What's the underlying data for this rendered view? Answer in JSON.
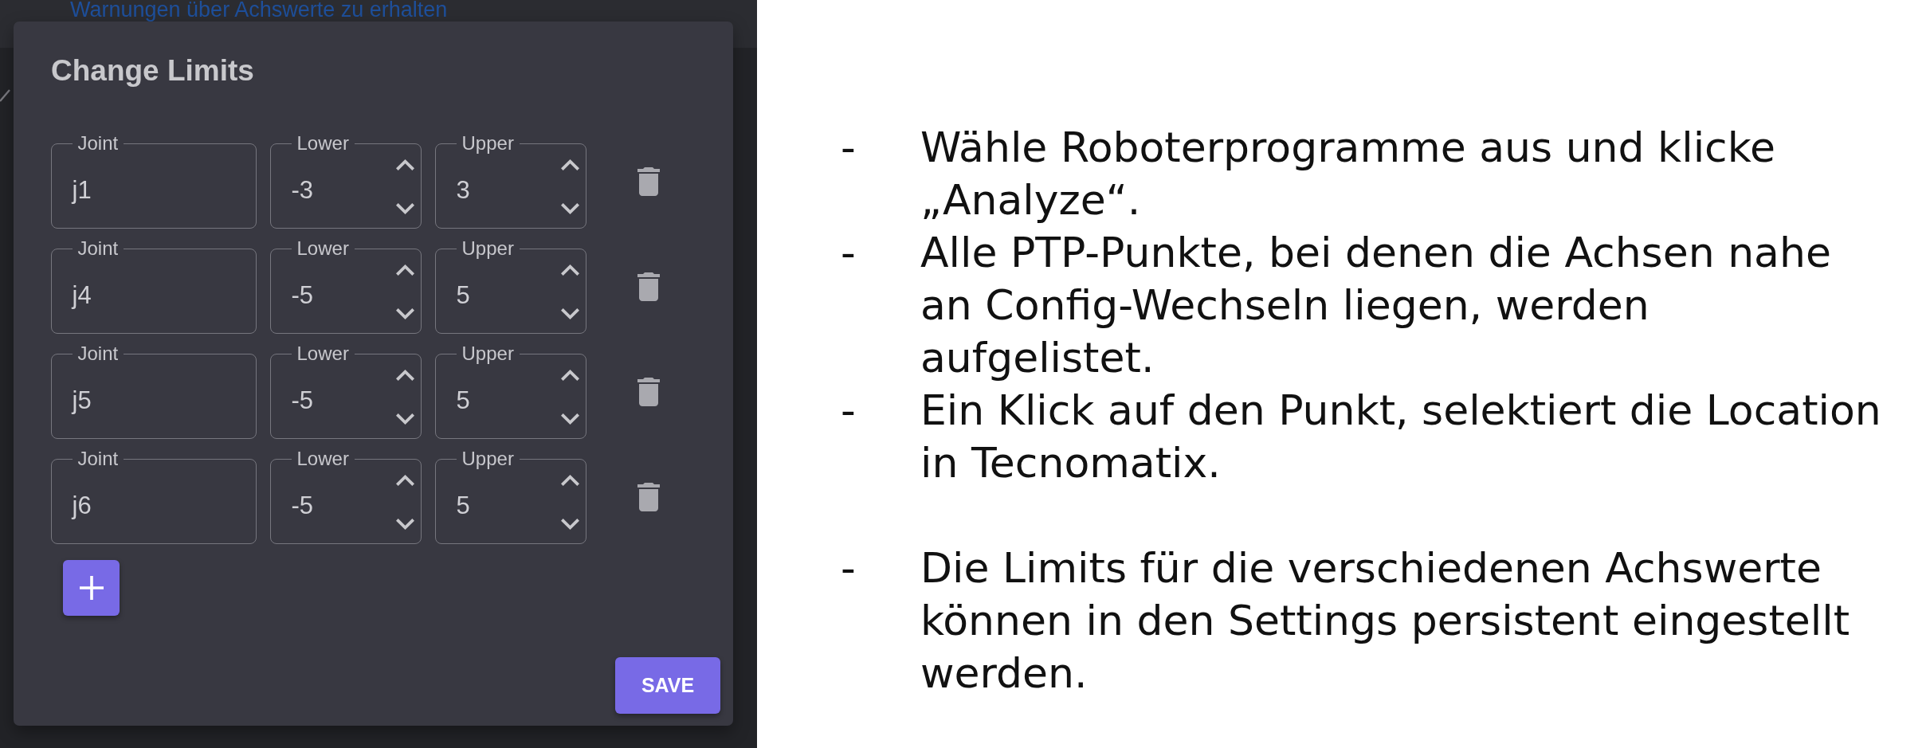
{
  "background": {
    "link": "Warnungen über Achswerte zu erhalten"
  },
  "dialog": {
    "title": "Change Limits",
    "rows": [
      {
        "fields": [
          {
            "kind": "text",
            "label": "Joint",
            "value": "j1"
          },
          {
            "kind": "number",
            "label": "Lower",
            "value": "-3"
          },
          {
            "kind": "number",
            "label": "Upper",
            "value": "3"
          }
        ]
      },
      {
        "fields": [
          {
            "kind": "text",
            "label": "Joint",
            "value": "j4"
          },
          {
            "kind": "number",
            "label": "Lower",
            "value": "-5"
          },
          {
            "kind": "number",
            "label": "Upper",
            "value": "5"
          }
        ]
      },
      {
        "fields": [
          {
            "kind": "text",
            "label": "Joint",
            "value": "j5"
          },
          {
            "kind": "number",
            "label": "Lower",
            "value": "-5"
          },
          {
            "kind": "number",
            "label": "Upper",
            "value": "5"
          }
        ]
      },
      {
        "fields": [
          {
            "kind": "text",
            "label": "Joint",
            "value": "j6"
          },
          {
            "kind": "number",
            "label": "Lower",
            "value": "-5"
          },
          {
            "kind": "number",
            "label": "Upper",
            "value": "5"
          }
        ]
      }
    ],
    "save_button": "SAVE"
  },
  "note_groups": [
    {
      "items": [
        {
          "marker": "-",
          "text": "Wähle Roboterprogramme aus und klicke „Analyze“."
        },
        {
          "marker": "-",
          "text": "Alle PTP-Punkte, bei denen die Achsen nahe an Config-Wechseln liegen, werden aufgelistet."
        },
        {
          "marker": "-",
          "text": "Ein Klick auf den Punkt, selektiert die Location in Tecnomatix."
        }
      ]
    },
    {
      "items": [
        {
          "marker": "-",
          "text": "Die Limits für die verschiedenen Achswerte können in den Settings persistent eingestellt werden."
        }
      ]
    }
  ]
}
